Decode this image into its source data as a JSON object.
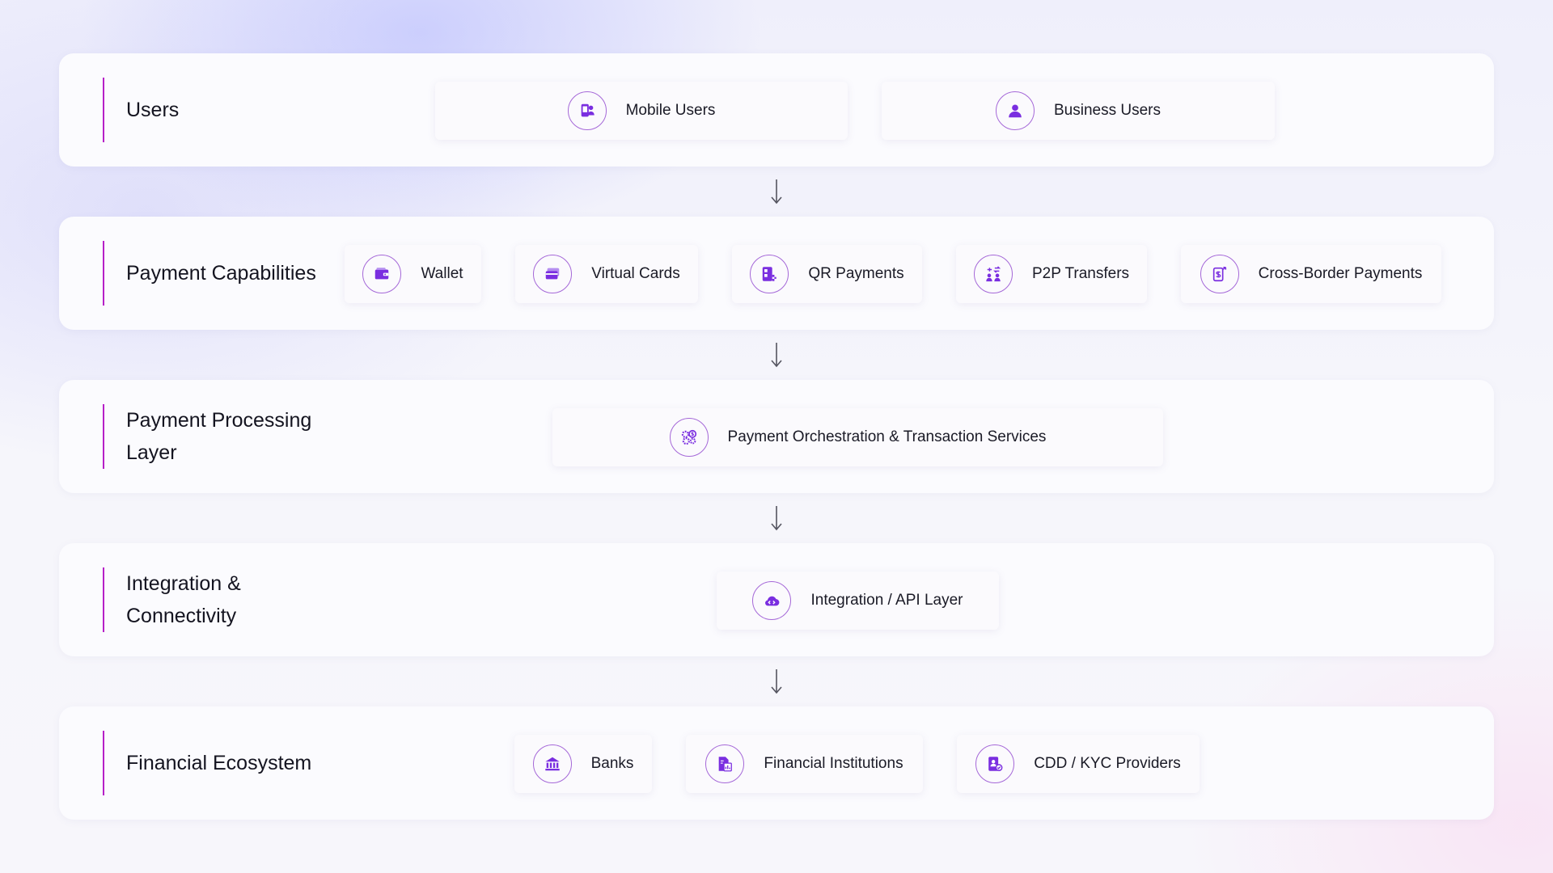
{
  "colors": {
    "accent": "#b61fc8",
    "icon": "#7a2ee0",
    "arrow": "#555560"
  },
  "layers": [
    {
      "title": "Users",
      "items": [
        {
          "label": "Mobile Users",
          "icon": "mobile-user-icon"
        },
        {
          "label": "Business Users",
          "icon": "user-icon"
        }
      ]
    },
    {
      "title": "Payment Capabilities",
      "items": [
        {
          "label": "Wallet",
          "icon": "wallet-icon"
        },
        {
          "label": "Virtual Cards",
          "icon": "card-icon"
        },
        {
          "label": "QR Payments",
          "icon": "qr-payment-icon"
        },
        {
          "label": "P2P Transfers",
          "icon": "p2p-transfer-icon"
        },
        {
          "label": "Cross-Border Payments",
          "icon": "cross-border-icon"
        }
      ]
    },
    {
      "title": "Payment Processing Layer",
      "items": [
        {
          "label": "Payment Orchestration & Transaction Services",
          "icon": "orchestration-gears-icon"
        }
      ]
    },
    {
      "title": "Integration & Connectivity",
      "items": [
        {
          "label": "Integration / API Layer",
          "icon": "cloud-api-icon"
        }
      ]
    },
    {
      "title": "Financial Ecosystem",
      "items": [
        {
          "label": "Banks",
          "icon": "bank-icon"
        },
        {
          "label": "Financial Institutions",
          "icon": "financial-document-icon"
        },
        {
          "label": "CDD / KYC Providers",
          "icon": "kyc-verification-icon"
        }
      ]
    }
  ]
}
